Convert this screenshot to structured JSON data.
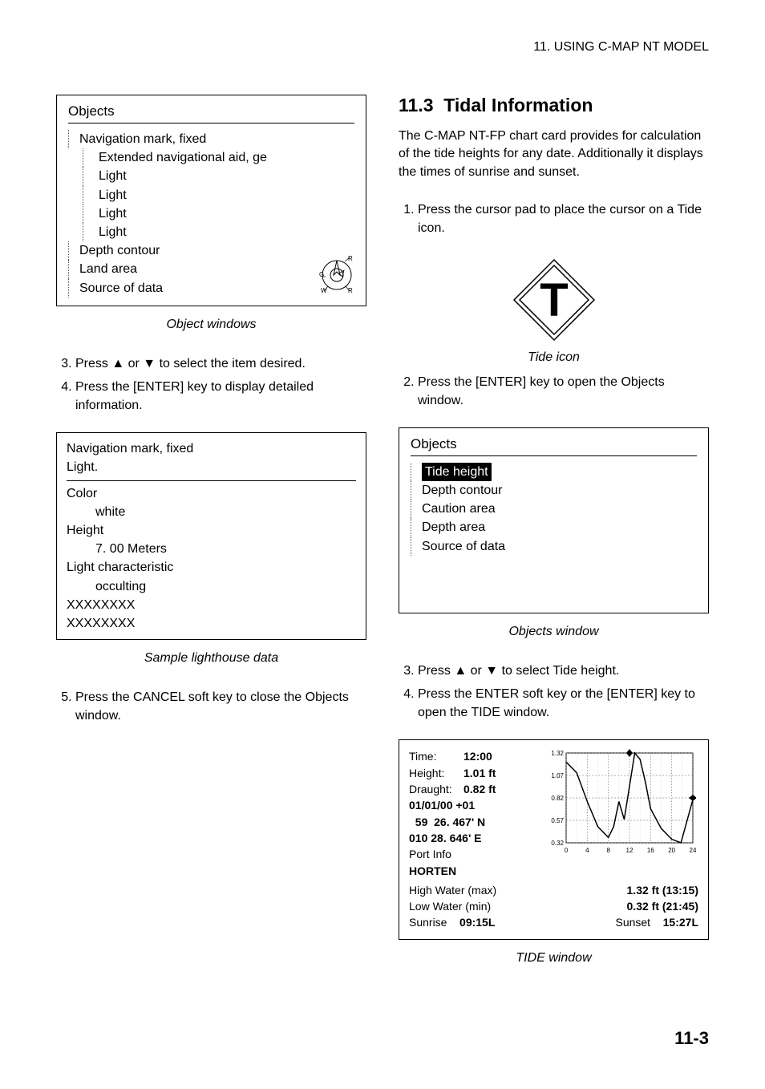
{
  "header": "11. USING C-MAP NT MODEL",
  "left": {
    "objects_box": {
      "title": "Objects",
      "items": [
        {
          "level": 1,
          "label": "Navigation mark, fixed"
        },
        {
          "level": 2,
          "label": "Extended navigational aid, ge"
        },
        {
          "level": 2,
          "label": "Light"
        },
        {
          "level": 2,
          "label": "Light"
        },
        {
          "level": 2,
          "label": "Light"
        },
        {
          "level": 2,
          "label": "Light"
        },
        {
          "level": 1,
          "label": "Depth contour"
        },
        {
          "level": 1,
          "label": "Land area"
        },
        {
          "level": 1,
          "label": "Source of data"
        }
      ],
      "compass_labels": [
        "R",
        "G",
        "W",
        "R"
      ]
    },
    "caption1": "Object windows",
    "steps1": [
      "Press ▲ or ▼ to select the item desired.",
      "Press the [ENTER] key to display detailed information."
    ],
    "steps1_start": 3,
    "data_box": {
      "line1": "Navigation mark, fixed",
      "line2": "Light.",
      "color_lbl": "Color",
      "color_val": "white",
      "height_lbl": "Height",
      "height_val": "7. 00 Meters",
      "char_lbl": "Light characteristic",
      "char_val": "occulting",
      "x1": "XXXXXXXX",
      "x2": "XXXXXXXX"
    },
    "caption2": "Sample lighthouse data",
    "steps2": [
      "Press the CANCEL soft key to close the Objects window."
    ],
    "steps2_start": 5
  },
  "right": {
    "section_num": "11.3",
    "section_title": "Tidal Information",
    "intro": "The C-MAP NT-FP chart card provides for calculation of the tide heights for any date. Additionally it displays the times of sunrise and sunset.",
    "steps1": [
      "Press the cursor pad to place the cursor on a Tide icon."
    ],
    "steps1_start": 1,
    "tide_icon_letter": "T",
    "tide_icon_caption": "Tide icon",
    "steps2": [
      "Press the [ENTER] key to open the Objects window."
    ],
    "steps2_start": 2,
    "objects_box": {
      "title": "Objects",
      "items": [
        {
          "level": 1,
          "label": "Tide height",
          "hl": true
        },
        {
          "level": 1,
          "label": "Depth contour"
        },
        {
          "level": 1,
          "label": "Caution area"
        },
        {
          "level": 1,
          "label": "Depth area"
        },
        {
          "level": 1,
          "label": "Source of data"
        }
      ]
    },
    "caption1": "Objects window",
    "steps3": [
      "Press ▲ or ▼ to select Tide height.",
      "Press the ENTER soft key or the [ENTER] key to open the TIDE window."
    ],
    "steps3_start": 3,
    "tide_window": {
      "time_lbl": "Time:",
      "time_val": "12:00",
      "height_lbl": "Height:",
      "height_val": "1.01 ft",
      "draught_lbl": "Draught:",
      "draught_val": "0.82 ft",
      "date": "01/01/00  +01",
      "lat": "  59  26. 467' N",
      "lon": "010  28. 646' E",
      "port_lbl": "Port Info",
      "port_name": "HORTEN",
      "high_lbl": "High Water (max)",
      "high_val": "1.32 ft (13:15)",
      "low_lbl": "Low Water (min)",
      "low_val": "0.32 ft (21:45)",
      "sunrise_lbl": "Sunrise",
      "sunrise_val": "09:15L",
      "sunset_lbl": "Sunset",
      "sunset_val": "15:27L"
    },
    "caption2": "TIDE window"
  },
  "chart_data": {
    "type": "line",
    "title": "",
    "xlabel": "",
    "ylabel": "",
    "x_ticks": [
      0,
      4,
      8,
      12,
      16,
      20,
      24
    ],
    "y_ticks": [
      0.32,
      0.57,
      0.82,
      1.07,
      1.32
    ],
    "xlim": [
      0,
      24
    ],
    "ylim": [
      0.32,
      1.32
    ],
    "cursor_x": 12,
    "draught_line": 0.82,
    "series": [
      {
        "name": "tide",
        "x": [
          0,
          2,
          4,
          6,
          8,
          9,
          10,
          11,
          12,
          13,
          14,
          15,
          16,
          18,
          20,
          21.75,
          24
        ],
        "y": [
          1.22,
          1.1,
          0.78,
          0.5,
          0.38,
          0.5,
          0.78,
          0.58,
          0.95,
          1.32,
          1.25,
          1.0,
          0.7,
          0.48,
          0.36,
          0.32,
          0.8
        ]
      }
    ]
  },
  "page_num": "11-3"
}
